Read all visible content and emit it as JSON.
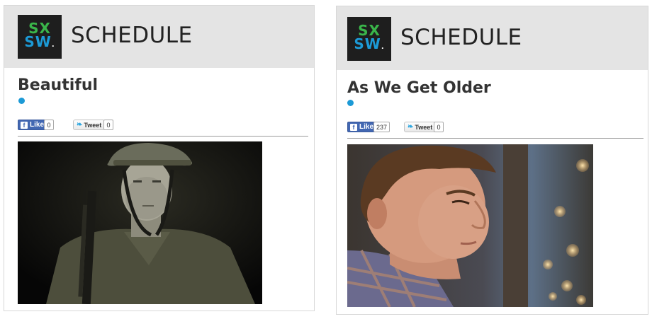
{
  "cards": [
    {
      "logo": {
        "line1": "SX",
        "line2": "SW",
        "dot": "."
      },
      "header_title": "SCHEDULE",
      "event_title": "Beautiful",
      "like_label": "Like",
      "like_count": "0",
      "tweet_label": "Tweet",
      "tweet_count": "0",
      "photo_description": "soldier-in-helmet"
    },
    {
      "logo": {
        "line1": "SX",
        "line2": "SW",
        "dot": "."
      },
      "header_title": "SCHEDULE",
      "event_title": "As We Get Older",
      "like_label": "Like",
      "like_count": "237",
      "tweet_label": "Tweet",
      "tweet_count": "0",
      "photo_description": "young-man-profile-bokeh"
    }
  ],
  "colors": {
    "header_bg": "#e4e4e4",
    "accent_blue": "#1c9ad6",
    "facebook_blue": "#4267b2",
    "logo_green": "#3ab54a",
    "logo_orange": "#f7941d"
  }
}
